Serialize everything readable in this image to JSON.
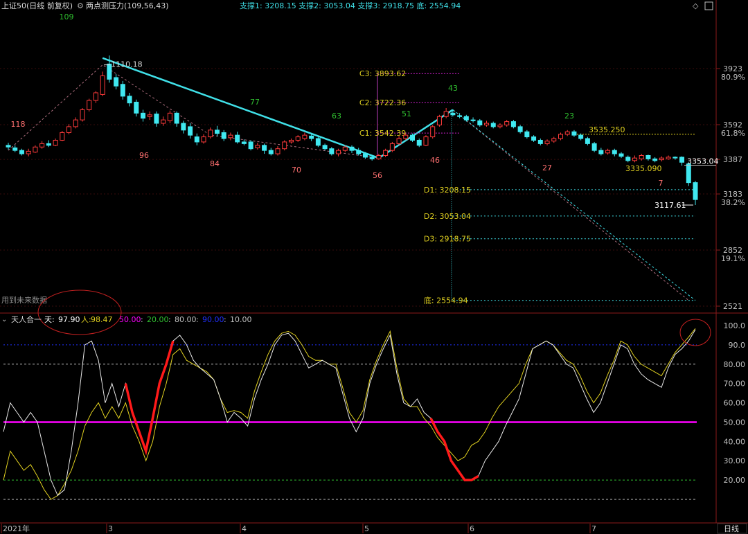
{
  "header": {
    "title": "上证50(日线 前复权)",
    "indicator": "两点测压力(109,56,43)",
    "supports": "支撑1: 3208.15  支撑2: 3053.04  支撑3: 2918.75  底: 2554.94"
  },
  "colors": {
    "bg": "#000000",
    "up": "#ff3b3b",
    "down": "#40e8f0",
    "trend": "#40e0e8",
    "green_label": "#30c030",
    "red_label": "#ff7070",
    "yellow": "#e0d020",
    "magenta": "#ff00ff",
    "white_line": "#e8e8e8",
    "axis_text": "#c0c0c0",
    "pane_border": "#8b1a1a"
  },
  "price_axis": {
    "ticks": [
      {
        "price": 3923,
        "label": "3923",
        "pct": "80.9%"
      },
      {
        "price": 3592,
        "label": "3592",
        "pct": "61.8%"
      },
      {
        "price": 3387,
        "label": "3387",
        "pct": ""
      },
      {
        "price": 3183,
        "label": "3183",
        "pct": "38.2%"
      },
      {
        "price": 2852,
        "label": "2852",
        "pct": "19.1%"
      },
      {
        "price": 2521,
        "label": "2521",
        "pct": ""
      }
    ]
  },
  "price_labels": [
    {
      "text": "1110.18",
      "kind": "high"
    },
    {
      "text": "3117.61",
      "kind": "low"
    },
    {
      "text": "3353.04",
      "kind": "current"
    },
    {
      "text": "3535.250",
      "kind": "level"
    },
    {
      "text": "3335.090",
      "kind": "level2"
    }
  ],
  "count_labels": [
    {
      "text": "109",
      "color": "green"
    },
    {
      "text": "118",
      "color": "red"
    },
    {
      "text": "96",
      "color": "red"
    },
    {
      "text": "84",
      "color": "red"
    },
    {
      "text": "77",
      "color": "green"
    },
    {
      "text": "70",
      "color": "red"
    },
    {
      "text": "63",
      "color": "green"
    },
    {
      "text": "56",
      "color": "red"
    },
    {
      "text": "51",
      "color": "green"
    },
    {
      "text": "46",
      "color": "red"
    },
    {
      "text": "43",
      "color": "green"
    },
    {
      "text": "27",
      "color": "red"
    },
    {
      "text": "23",
      "color": "green"
    },
    {
      "text": "7",
      "color": "red"
    }
  ],
  "levels": {
    "C": [
      {
        "label": "C3: 3893.62",
        "price": 3893.62
      },
      {
        "label": "C2: 3722.36",
        "price": 3722.36
      },
      {
        "label": "C1: 3542.39",
        "price": 3542.39
      }
    ],
    "D": [
      {
        "label": "D1: 3208.15",
        "price": 3208.15
      },
      {
        "label": "D2: 3053.04",
        "price": 3053.04
      },
      {
        "label": "D3: 2918.75",
        "price": 2918.75
      },
      {
        "label": "底: 2554.94",
        "price": 2554.94
      }
    ],
    "line_3535": 3535.25
  },
  "notes": {
    "future_data": "用到未来数据"
  },
  "indicator_pane": {
    "name": "天人合一",
    "tian_label": "天:",
    "tian_value": "97.90",
    "ren_label": "人:",
    "ren_value": "98.47",
    "params": [
      {
        "text": "50.00",
        "color": "#ff00ff"
      },
      {
        "text": "20.00",
        "color": "#30c030"
      },
      {
        "text": "80.00",
        "color": "#c0c0c0"
      },
      {
        "text": "90.00",
        "color": "#2030ff"
      },
      {
        "text": "10.00",
        "color": "#c0c0c0"
      }
    ],
    "axis_labels": [
      "100.0",
      "90.0",
      "80.00",
      "70.00",
      "60.00",
      "50.00",
      "40.00",
      "30.00",
      "20.00"
    ]
  },
  "time_axis": {
    "labels": [
      "2021年",
      "3",
      "4",
      "5",
      "6",
      "7"
    ],
    "period_button": "日线"
  },
  "chart_data": {
    "type": "candlestick",
    "title": "上证50(日线 前复权)",
    "ylim": [
      2480,
      4050
    ],
    "candles": [
      [
        3470,
        3460,
        3485,
        3445
      ],
      [
        3455,
        3440,
        3470,
        3430
      ],
      [
        3440,
        3420,
        3450,
        3410
      ],
      [
        3420,
        3435,
        3450,
        3405
      ],
      [
        3430,
        3460,
        3470,
        3425
      ],
      [
        3460,
        3480,
        3495,
        3450
      ],
      [
        3480,
        3470,
        3500,
        3460
      ],
      [
        3470,
        3500,
        3510,
        3465
      ],
      [
        3500,
        3545,
        3555,
        3495
      ],
      [
        3545,
        3580,
        3595,
        3535
      ],
      [
        3580,
        3620,
        3635,
        3570
      ],
      [
        3620,
        3680,
        3690,
        3610
      ],
      [
        3680,
        3735,
        3745,
        3670
      ],
      [
        3735,
        3780,
        3790,
        3720
      ],
      [
        3770,
        3880,
        3905,
        3760
      ],
      [
        3950,
        3860,
        4000,
        3840
      ],
      [
        3870,
        3820,
        3890,
        3800
      ],
      [
        3830,
        3760,
        3850,
        3740
      ],
      [
        3760,
        3720,
        3780,
        3700
      ],
      [
        3725,
        3660,
        3740,
        3640
      ],
      [
        3660,
        3630,
        3680,
        3610
      ],
      [
        3640,
        3650,
        3670,
        3620
      ],
      [
        3655,
        3600,
        3670,
        3580
      ],
      [
        3600,
        3620,
        3640,
        3585
      ],
      [
        3615,
        3660,
        3675,
        3600
      ],
      [
        3660,
        3600,
        3670,
        3580
      ],
      [
        3600,
        3560,
        3615,
        3540
      ],
      [
        3580,
        3530,
        3600,
        3510
      ],
      [
        3520,
        3490,
        3540,
        3470
      ],
      [
        3490,
        3520,
        3535,
        3480
      ],
      [
        3520,
        3560,
        3575,
        3510
      ],
      [
        3560,
        3540,
        3585,
        3525
      ],
      [
        3545,
        3510,
        3560,
        3495
      ],
      [
        3515,
        3530,
        3545,
        3500
      ],
      [
        3530,
        3490,
        3550,
        3480
      ],
      [
        3490,
        3480,
        3505,
        3470
      ],
      [
        3490,
        3450,
        3500,
        3440
      ],
      [
        3455,
        3470,
        3485,
        3445
      ],
      [
        3470,
        3440,
        3480,
        3420
      ],
      [
        3440,
        3420,
        3455,
        3410
      ],
      [
        3420,
        3450,
        3465,
        3410
      ],
      [
        3450,
        3490,
        3500,
        3440
      ],
      [
        3490,
        3500,
        3510,
        3480
      ],
      [
        3500,
        3520,
        3530,
        3490
      ],
      [
        3510,
        3530,
        3545,
        3500
      ],
      [
        3525,
        3510,
        3540,
        3495
      ],
      [
        3510,
        3470,
        3520,
        3460
      ],
      [
        3470,
        3450,
        3480,
        3440
      ],
      [
        3450,
        3420,
        3460,
        3410
      ],
      [
        3420,
        3440,
        3450,
        3405
      ],
      [
        3440,
        3460,
        3470,
        3430
      ],
      [
        3460,
        3440,
        3470,
        3425
      ],
      [
        3440,
        3420,
        3455,
        3410
      ],
      [
        3420,
        3400,
        3430,
        3390
      ],
      [
        3400,
        3390,
        3410,
        3380
      ],
      [
        3390,
        3410,
        3420,
        3385
      ],
      [
        3410,
        3440,
        3450,
        3400
      ],
      [
        3440,
        3480,
        3490,
        3430
      ],
      [
        3480,
        3510,
        3525,
        3470
      ],
      [
        3510,
        3530,
        3540,
        3500
      ],
      [
        3530,
        3500,
        3540,
        3490
      ],
      [
        3500,
        3470,
        3510,
        3460
      ],
      [
        3470,
        3520,
        3530,
        3465
      ],
      [
        3520,
        3580,
        3590,
        3510
      ],
      [
        3590,
        3640,
        3650,
        3580
      ],
      [
        3640,
        3670,
        3690,
        3630
      ],
      [
        3660,
        3650,
        3680,
        3640
      ],
      [
        3645,
        3640,
        3660,
        3630
      ],
      [
        3640,
        3620,
        3650,
        3610
      ],
      [
        3620,
        3615,
        3635,
        3605
      ],
      [
        3615,
        3590,
        3625,
        3580
      ],
      [
        3590,
        3600,
        3615,
        3580
      ],
      [
        3600,
        3580,
        3610,
        3570
      ],
      [
        3580,
        3590,
        3600,
        3570
      ],
      [
        3590,
        3610,
        3620,
        3580
      ],
      [
        3610,
        3580,
        3620,
        3570
      ],
      [
        3580,
        3550,
        3590,
        3540
      ],
      [
        3550,
        3520,
        3560,
        3510
      ],
      [
        3520,
        3500,
        3530,
        3490
      ],
      [
        3500,
        3480,
        3510,
        3470
      ],
      [
        3480,
        3495,
        3505,
        3470
      ],
      [
        3495,
        3510,
        3520,
        3485
      ],
      [
        3510,
        3535,
        3545,
        3500
      ],
      [
        3535,
        3550,
        3560,
        3525
      ],
      [
        3550,
        3530,
        3560,
        3520
      ],
      [
        3530,
        3510,
        3540,
        3500
      ],
      [
        3510,
        3480,
        3520,
        3470
      ],
      [
        3480,
        3440,
        3490,
        3430
      ],
      [
        3440,
        3420,
        3455,
        3410
      ],
      [
        3425,
        3440,
        3450,
        3415
      ],
      [
        3440,
        3420,
        3450,
        3405
      ],
      [
        3420,
        3405,
        3430,
        3395
      ],
      [
        3400,
        3380,
        3410,
        3370
      ],
      [
        3380,
        3395,
        3410,
        3370
      ],
      [
        3390,
        3410,
        3420,
        3380
      ],
      [
        3410,
        3390,
        3415,
        3380
      ],
      [
        3390,
        3380,
        3400,
        3370
      ],
      [
        3385,
        3395,
        3405,
        3375
      ],
      [
        3390,
        3400,
        3410,
        3385
      ],
      [
        3400,
        3395,
        3405,
        3385
      ],
      [
        3400,
        3370,
        3405,
        3350
      ],
      [
        3360,
        3250,
        3370,
        3230
      ],
      [
        3250,
        3150,
        3260,
        3117.61
      ]
    ],
    "indicator_series": [
      {
        "name": "天",
        "values": [
          45,
          60,
          55,
          50,
          55,
          50,
          35,
          20,
          12,
          15,
          35,
          60,
          90,
          92,
          82,
          60,
          70,
          58,
          70,
          55,
          45,
          35,
          52,
          70,
          80,
          92,
          95,
          90,
          82,
          78,
          75,
          72,
          62,
          50,
          55,
          52,
          48,
          62,
          72,
          80,
          90,
          95,
          96,
          92,
          85,
          78,
          80,
          82,
          80,
          78,
          65,
          52,
          45,
          52,
          70,
          80,
          88,
          95,
          75,
          60,
          58,
          62,
          55,
          52,
          45,
          40,
          30,
          25,
          20,
          20,
          22,
          30,
          35,
          40,
          48,
          55,
          62,
          75,
          88,
          90,
          92,
          90,
          85,
          80,
          78,
          70,
          62,
          55,
          60,
          70,
          80,
          90,
          88,
          80,
          75,
          72,
          70,
          68,
          78,
          85,
          88,
          92,
          97.9
        ]
      },
      {
        "name": "人",
        "values": [
          20,
          35,
          30,
          25,
          28,
          22,
          15,
          10,
          12,
          18,
          25,
          35,
          48,
          55,
          60,
          52,
          58,
          52,
          60,
          48,
          40,
          30,
          40,
          58,
          70,
          85,
          88,
          82,
          80,
          78,
          76,
          72,
          62,
          55,
          56,
          55,
          52,
          66,
          76,
          85,
          92,
          96,
          97,
          95,
          90,
          84,
          82,
          82,
          80,
          80,
          68,
          55,
          50,
          56,
          72,
          82,
          90,
          97,
          78,
          62,
          58,
          58,
          52,
          48,
          42,
          38,
          34,
          30,
          32,
          38,
          40,
          45,
          52,
          58,
          62,
          66,
          70,
          80,
          88,
          90,
          92,
          90,
          86,
          82,
          80,
          74,
          66,
          60,
          65,
          74,
          82,
          92,
          90,
          84,
          80,
          78,
          76,
          74,
          80,
          86,
          90,
          94,
          98.47
        ]
      }
    ]
  }
}
